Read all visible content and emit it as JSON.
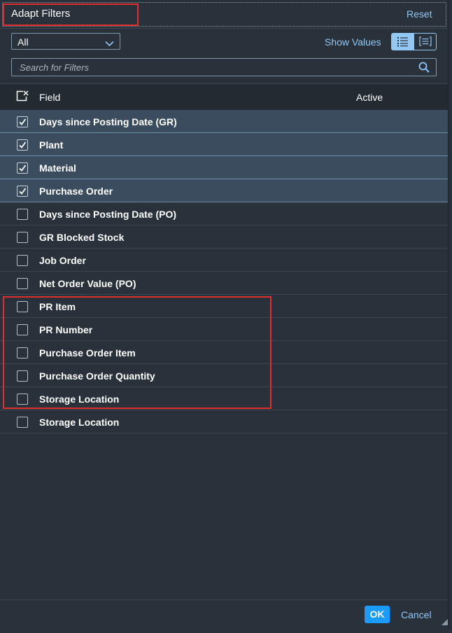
{
  "header": {
    "title": "Adapt Filters",
    "reset_label": "Reset"
  },
  "toolbar": {
    "filter_select_value": "All",
    "show_values_label": "Show Values",
    "view_mode_list_icon": "list-view-icon",
    "view_mode_group_icon": "group-view-icon",
    "search_placeholder": "Search for Filters"
  },
  "table": {
    "columns": [
      "Field",
      "Active"
    ],
    "rows": [
      {
        "label": "Days since Posting Date (GR)",
        "checked": true
      },
      {
        "label": "Plant",
        "checked": true
      },
      {
        "label": "Material",
        "checked": true
      },
      {
        "label": "Purchase Order",
        "checked": true
      },
      {
        "label": "Days since Posting Date (PO)",
        "checked": false
      },
      {
        "label": "GR Blocked Stock",
        "checked": false
      },
      {
        "label": "Job Order",
        "checked": false
      },
      {
        "label": "Net Order Value (PO)",
        "checked": false
      },
      {
        "label": "PR Item",
        "checked": false
      },
      {
        "label": "PR Number",
        "checked": false
      },
      {
        "label": "Purchase Order Item",
        "checked": false
      },
      {
        "label": "Purchase Order Quantity",
        "checked": false
      },
      {
        "label": "Storage Location",
        "checked": false
      },
      {
        "label": "Storage Location",
        "checked": false
      }
    ]
  },
  "footer": {
    "ok_label": "OK",
    "cancel_label": "Cancel"
  },
  "colors": {
    "background": "#29313a",
    "selected_row": "#3a4c5d",
    "link": "#91c8f6",
    "emphasized_button": "#1a9bff",
    "annotation_red": "#e02d2d"
  }
}
